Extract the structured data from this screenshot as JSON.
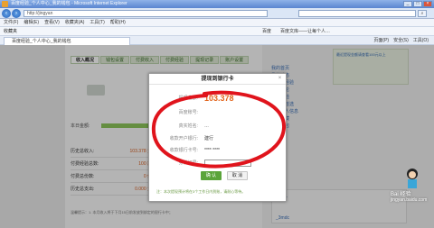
{
  "browser": {
    "title": "百度经验_个人中心_我的钱包 - Microsoft Internet Explorer",
    "url": "http://jingyan",
    "menu": [
      "文件(F)",
      "编辑(E)",
      "查看(V)",
      "收藏夹(A)",
      "工具(T)",
      "帮助(H)"
    ],
    "favorites_label": "收藏夹",
    "fav_items": [
      "百度",
      "百度文库——让每个人…"
    ],
    "tab_title": "百度经验_个人中心_我的钱包",
    "tools": [
      "页面(P)",
      "安全(S)",
      "工具(O)"
    ]
  },
  "page": {
    "sub_tabs": [
      "收入概况",
      "钱包设置",
      "付费收入",
      "付费经验",
      "提现记录",
      "账户设置"
    ],
    "today_label": "本日金额:",
    "stats": [
      {
        "label": "历史总收入:",
        "value": "103.378 元"
      },
      {
        "label": "付费经验总数:",
        "value": "100 篇"
      },
      {
        "label": "付费总份数:",
        "value": "0 份"
      },
      {
        "label": "历史总支出:",
        "value": "0.000 元"
      }
    ],
    "bottom_note": "温馨提示：1. 本月收入将于下月15日前发放到绑定的银行卡中；",
    "right_links": [
      "我的首页",
      "我的动态",
      "发布新经验",
      "我的讨论",
      "我的经验",
      "设置为首选",
      "填写个人信息",
      "我的收藏",
      "我的钱包"
    ],
    "right_box_text": "最近提现金额请查看100元以上",
    "right_user1": "xcxyy",
    "right_user2": "_3mdc"
  },
  "modal": {
    "title": "提现到银行卡",
    "close": "×",
    "rows": [
      {
        "key": "提现金额:",
        "value": "103.378"
      },
      {
        "key": "百度账号:",
        "value": ""
      },
      {
        "key": "真实姓名:",
        "value": "…"
      },
      {
        "key": "收款开户银行:",
        "value": "建行"
      },
      {
        "key": "收款银行卡号:",
        "value": "**** ****"
      },
      {
        "key": "身份证号:",
        "value": ""
      }
    ],
    "confirm": "确 认",
    "cancel": "取 消",
    "note": "注：本次提现预计将在3个工作日内到账，请耐心等待。"
  },
  "watermark": {
    "main": "Bai 经验",
    "sub": "jingyan.baidu.com"
  },
  "colors": {
    "annotation_red": "#e0141c",
    "amount_orange": "#e2641b",
    "confirm_green": "#5aa43a"
  }
}
